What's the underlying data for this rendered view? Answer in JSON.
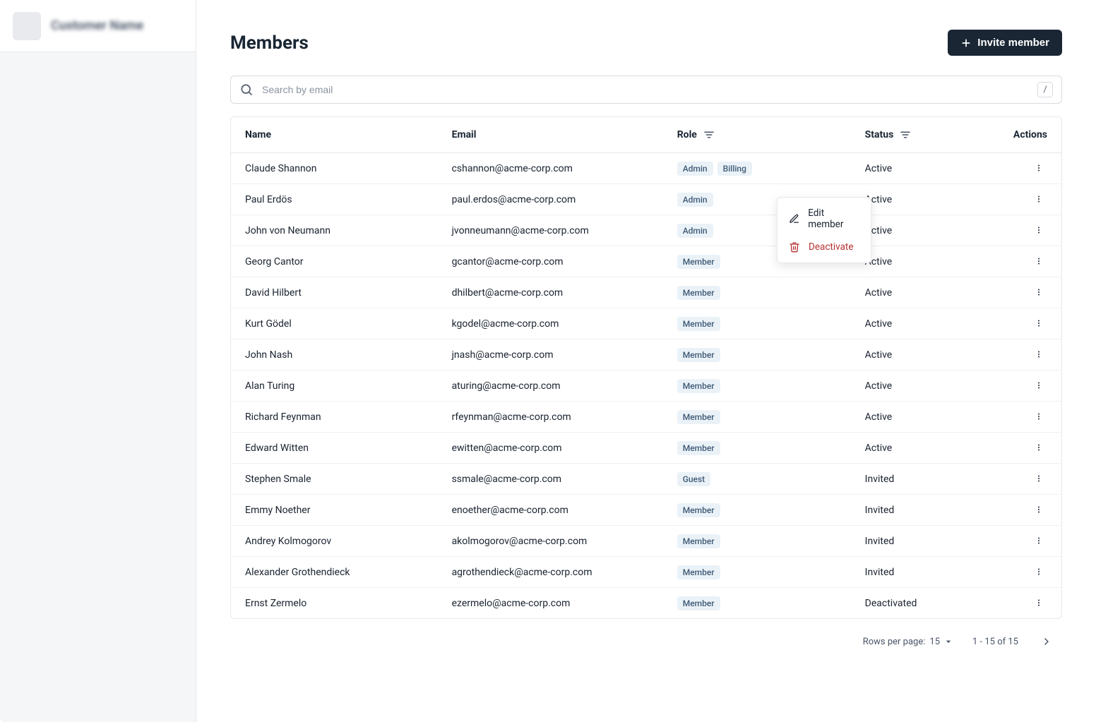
{
  "sidebar": {
    "org_name": "Customer Name"
  },
  "page": {
    "title": "Members",
    "invite_button": "Invite member"
  },
  "search": {
    "placeholder": "Search by email",
    "kbd_hint": "/"
  },
  "table": {
    "headers": {
      "name": "Name",
      "email": "Email",
      "role": "Role",
      "status": "Status",
      "actions": "Actions"
    },
    "rows": [
      {
        "name": "Claude Shannon",
        "email": "cshannon@acme-corp.com",
        "roles": [
          "Admin",
          "Billing"
        ],
        "status": "Active"
      },
      {
        "name": "Paul Erdös",
        "email": "paul.erdos@acme-corp.com",
        "roles": [
          "Admin"
        ],
        "status": "Active"
      },
      {
        "name": "John von Neumann",
        "email": "jvonneumann@acme-corp.com",
        "roles": [
          "Admin"
        ],
        "status": "Active"
      },
      {
        "name": "Georg Cantor",
        "email": "gcantor@acme-corp.com",
        "roles": [
          "Member"
        ],
        "status": "Active"
      },
      {
        "name": "David Hilbert",
        "email": "dhilbert@acme-corp.com",
        "roles": [
          "Member"
        ],
        "status": "Active"
      },
      {
        "name": "Kurt Gödel",
        "email": "kgodel@acme-corp.com",
        "roles": [
          "Member"
        ],
        "status": "Active"
      },
      {
        "name": "John Nash",
        "email": "jnash@acme-corp.com",
        "roles": [
          "Member"
        ],
        "status": "Active"
      },
      {
        "name": "Alan Turing",
        "email": "aturing@acme-corp.com",
        "roles": [
          "Member"
        ],
        "status": "Active"
      },
      {
        "name": "Richard Feynman",
        "email": "rfeynman@acme-corp.com",
        "roles": [
          "Member"
        ],
        "status": "Active"
      },
      {
        "name": "Edward Witten",
        "email": "ewitten@acme-corp.com",
        "roles": [
          "Member"
        ],
        "status": "Active"
      },
      {
        "name": "Stephen Smale",
        "email": "ssmale@acme-corp.com",
        "roles": [
          "Guest"
        ],
        "status": "Invited"
      },
      {
        "name": "Emmy Noether",
        "email": "enoether@acme-corp.com",
        "roles": [
          "Member"
        ],
        "status": "Invited"
      },
      {
        "name": "Andrey Kolmogorov",
        "email": "akolmogorov@acme-corp.com",
        "roles": [
          "Member"
        ],
        "status": "Invited"
      },
      {
        "name": "Alexander Grothendieck",
        "email": "agrothendieck@acme-corp.com",
        "roles": [
          "Member"
        ],
        "status": "Invited"
      },
      {
        "name": "Ernst Zermelo",
        "email": "ezermelo@acme-corp.com",
        "roles": [
          "Member"
        ],
        "status": "Deactivated"
      }
    ]
  },
  "pagination": {
    "rows_per_page_label": "Rows per page:",
    "rows_per_page_value": "15",
    "range_label": "1 - 15 of 15"
  },
  "context_menu": {
    "edit": "Edit member",
    "deactivate": "Deactivate"
  }
}
